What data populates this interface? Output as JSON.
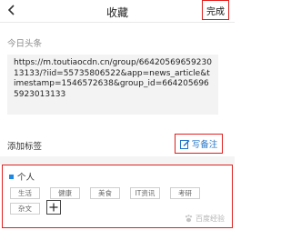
{
  "header": {
    "title": "收藏",
    "done_label": "完成",
    "back_icon": "chevron-left-icon"
  },
  "source": {
    "name": "今日头条",
    "url": "https://m.toutiaocdn.cn/group/6642056965923013133/?iid=55735806522&app=news_article&timestamp=1546572638&group_id=6642056965923013133"
  },
  "tags": {
    "add_label": "添加标签",
    "write_note_label": "写备注",
    "note_icon": "pencil-note-icon",
    "group_title": "个人",
    "chips": [
      "生活",
      "健康",
      "美食",
      "IT资讯",
      "考研",
      "杂文"
    ],
    "add_icon": "plus-icon"
  },
  "watermark": {
    "text": "百度经验"
  },
  "colors": {
    "highlight_border": "#e02020",
    "accent_blue": "#1e88e5",
    "note_text": "#1f73c7",
    "url_bg": "#f3f3f3"
  }
}
